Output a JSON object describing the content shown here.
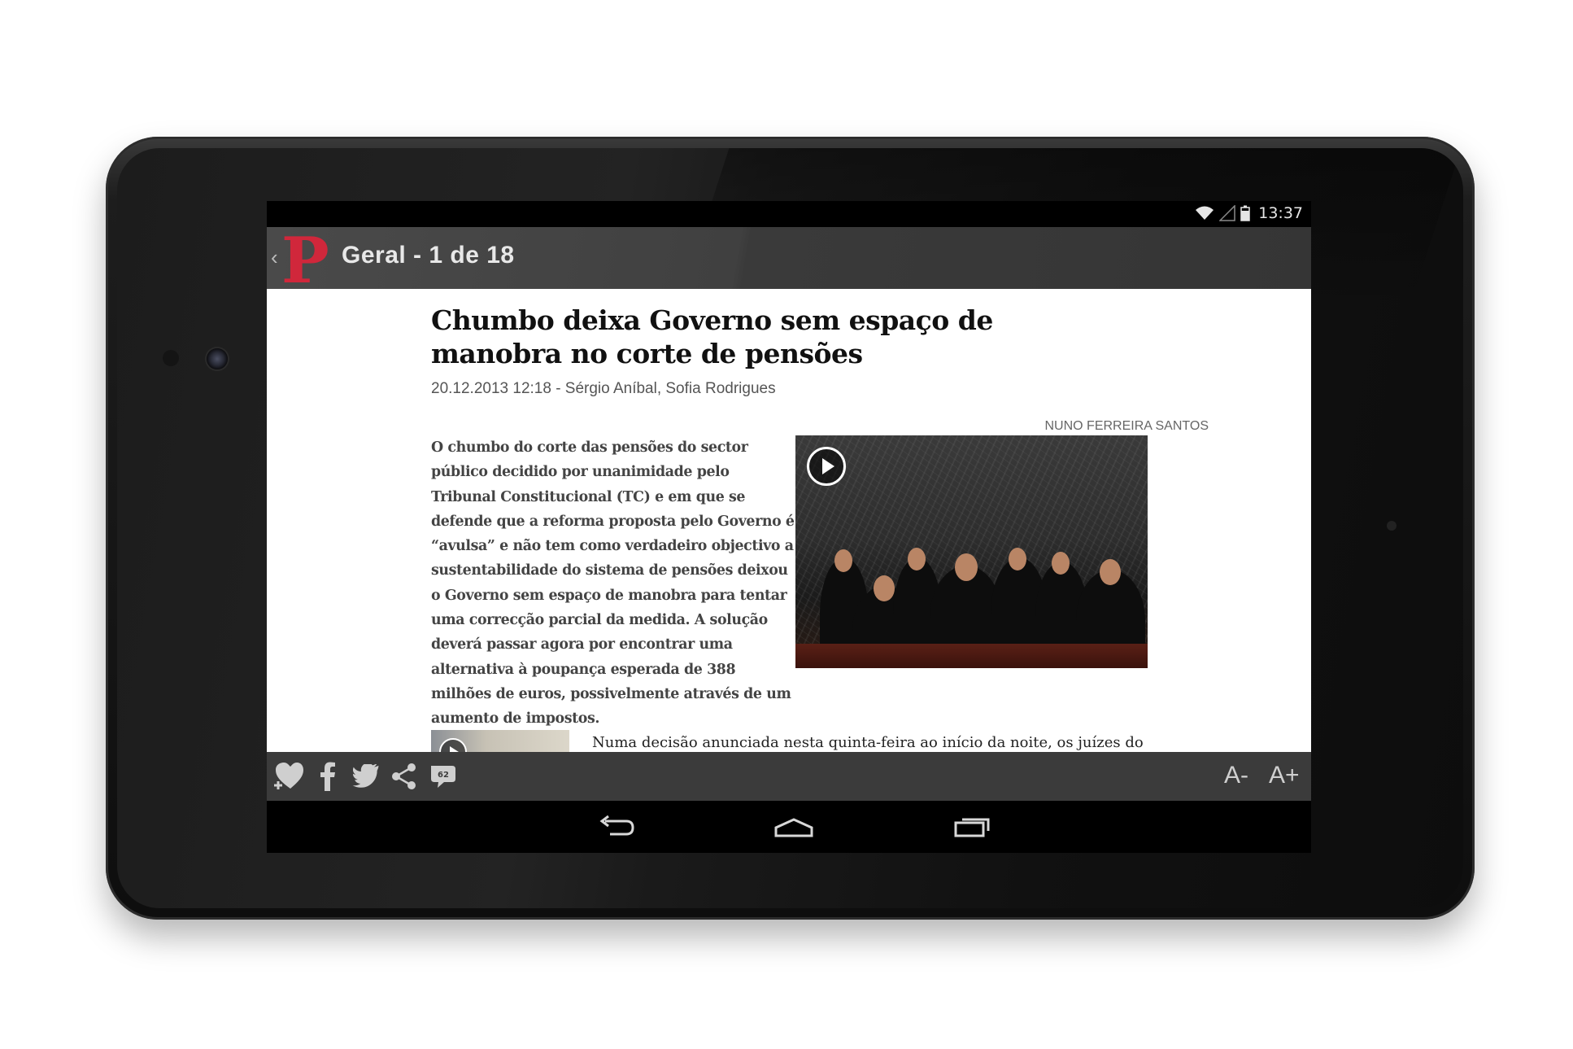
{
  "status_bar": {
    "time": "13:37"
  },
  "action_bar": {
    "section_title": "Geral - 1 de 18",
    "logo_letter": "P"
  },
  "article": {
    "headline": "Chumbo deixa Governo sem espaço de manobra no corte de pensões",
    "meta": "20.12.2013 12:18 - Sérgio Aníbal, Sofia Rodrigues",
    "lead": "O chumbo do corte das pensões do sector público decidido por unanimidade pelo Tribunal Constitucional (TC) e em que se defende que a reforma proposta pelo Governo é “avulsa” e não tem como verdadeiro objectivo a sustentabilidade do sistema de pensões deixou o Governo sem espaço de manobra para tentar uma correcção parcial da medida. A solução deverá passar agora por encontrar uma alternativa à poupança esperada de 388 milhões de euros, possivelmente através de um aumento de impostos.",
    "photo_credit": "NUNO FERREIRA SANTOS",
    "body_start": "Numa decisão anunciada nesta quinta-feira ao início da noite, os juízes do"
  },
  "toolbar": {
    "comment_count": "62",
    "font_decrease_label": "A-",
    "font_increase_label": "A+"
  },
  "colors": {
    "brand_red": "#d0273b",
    "action_bar": "#404040",
    "toolbar": "#3b3b3b"
  },
  "icons": [
    "wifi-icon",
    "signal-icon",
    "battery-icon",
    "back-chevron-icon",
    "favorite-add-icon",
    "facebook-icon",
    "twitter-icon",
    "share-icon",
    "comments-icon",
    "play-icon",
    "nav-back-icon",
    "nav-home-icon",
    "nav-recents-icon"
  ]
}
